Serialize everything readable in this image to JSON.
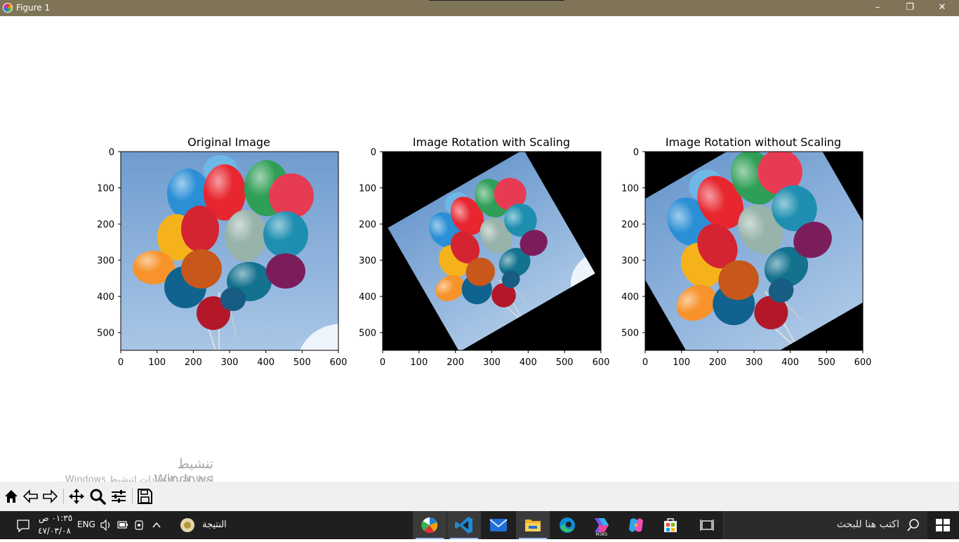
{
  "window": {
    "title": "Figure 1",
    "controls": {
      "minimize": "–",
      "maximize": "❐",
      "close": "✕"
    }
  },
  "figure": {
    "subplots": [
      {
        "title": "Original Image",
        "content": "balloons photo",
        "xticks": [
          "0",
          "100",
          "200",
          "300",
          "400",
          "500",
          "600"
        ],
        "yticks": [
          "0",
          "100",
          "200",
          "300",
          "400",
          "500"
        ]
      },
      {
        "title": "Image Rotation with Scaling",
        "content": "balloons photo rotated, scaled down, black fill",
        "xticks": [
          "0",
          "100",
          "200",
          "300",
          "400",
          "500",
          "600"
        ],
        "yticks": [
          "0",
          "100",
          "200",
          "300",
          "400",
          "500"
        ]
      },
      {
        "title": "Image Rotation without Scaling",
        "content": "balloons photo rotated, cropped corners, black fill",
        "xticks": [
          "0",
          "100",
          "200",
          "300",
          "400",
          "500",
          "600"
        ],
        "yticks": [
          "0",
          "100",
          "200",
          "300",
          "400",
          "500"
        ]
      }
    ]
  },
  "watermark": {
    "line1": "تنشيط Windows",
    "line2": "انتقل إلى الإعدادات لتنشيط Windows."
  },
  "toolbar": {
    "buttons": [
      "home-icon",
      "back-icon",
      "forward-icon",
      "pan-icon",
      "zoom-icon",
      "configure-subplots-icon",
      "save-icon"
    ]
  },
  "taskbar": {
    "notification_icon": "notification-icon",
    "clock_time": "٠١:٣٥ ص",
    "clock_date": "٤٧/٠٣/٠٨",
    "language": "ENG",
    "tray_icons": [
      "volume-icon",
      "battery-icon",
      "camera-icon",
      "chevron-up-icon"
    ],
    "widget_label": "النتيجة",
    "apps": [
      "matplotlib-figure",
      "vscode",
      "mail",
      "file-explorer",
      "edge",
      "m365",
      "copilot",
      "store"
    ],
    "taskview": "task-view-icon",
    "search_placeholder": "اكتب هنا للبحث",
    "start": "windows-start-icon"
  },
  "colors": {
    "titlebar": "#7f7458",
    "taskbar": "#1f1f1f",
    "toolbar": "#f0f0f0",
    "sky": "#7ea9d6"
  }
}
